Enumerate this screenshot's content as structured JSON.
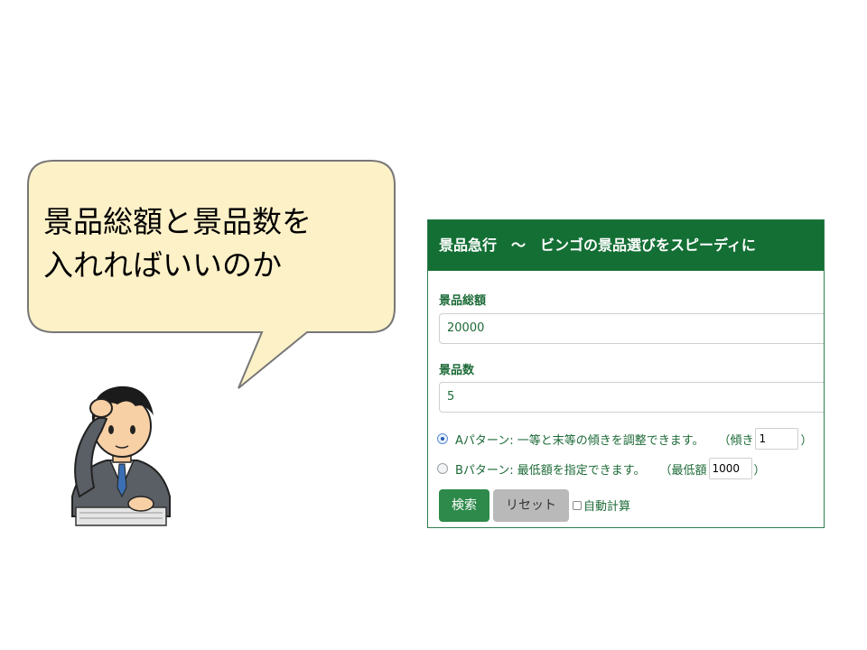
{
  "bubble": {
    "text": "景品総額と景品数を\n入れればいいのか"
  },
  "app": {
    "header_title": "景品急行　〜　ビンゴの景品選びをスピーディに",
    "total_label": "景品総額",
    "total_value": "20000",
    "count_label": "景品数",
    "count_value": "5",
    "pattern_a": {
      "label": "Aパターン: 一等と末等の傾きを調整できます。",
      "param_prefix": "（傾き",
      "param_value": "1",
      "param_suffix": "）",
      "selected": true
    },
    "pattern_b": {
      "label": "Bパターン: 最低額を指定できます。",
      "param_prefix": "（最低額",
      "param_value": "1000",
      "param_suffix": "）",
      "selected": false
    },
    "search_button": "検索",
    "reset_button": "リセット",
    "auto_calc_label": "自動計算",
    "colors": {
      "header_bg": "#146f35",
      "label_green": "#1c6a37",
      "search_btn": "#2d8a4a",
      "reset_btn": "#b9b9b9"
    }
  }
}
